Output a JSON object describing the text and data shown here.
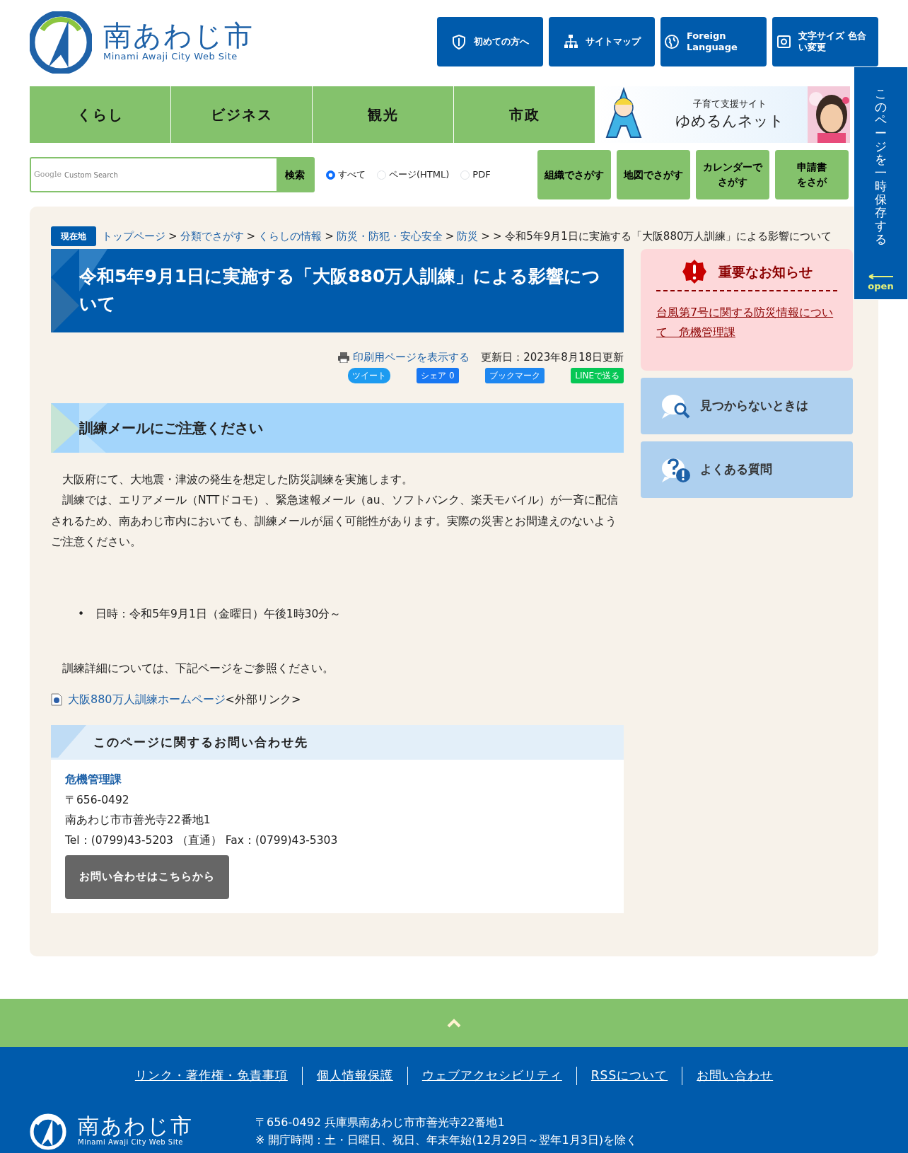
{
  "header": {
    "logo": {
      "name": "南あわじ市",
      "subtitle": "Minami Awaji City Web Site"
    },
    "buttons": [
      {
        "label": "初めての方へ"
      },
      {
        "label": "サイトマップ"
      },
      {
        "label": "Foreign Language"
      },
      {
        "label": "文字サイズ 色合い変更"
      }
    ]
  },
  "nav": {
    "items": [
      "くらし",
      "ビジネス",
      "観光",
      "市政"
    ],
    "banner": {
      "kicker": "子育て支援サイト",
      "title": "ゆめるんネット",
      "kind": "picture"
    }
  },
  "search": {
    "brand": "Google",
    "placeholder": "Custom Search",
    "button": "検索",
    "options": [
      {
        "label": "すべて",
        "selected": true
      },
      {
        "label": "ページ(HTML)",
        "selected": false
      },
      {
        "label": "PDF",
        "selected": false
      }
    ],
    "finders": [
      {
        "lines": [
          "組織でさがす"
        ]
      },
      {
        "lines": [
          "地図でさがす"
        ]
      },
      {
        "lines": [
          "カレンダーで",
          "さがす"
        ]
      },
      {
        "lines": [
          "申請書",
          "をさが"
        ]
      }
    ]
  },
  "side_tab": {
    "text": "このページを一時保存する",
    "action": "open"
  },
  "breadcrumb": {
    "label": "現在地",
    "parts": [
      {
        "kind": "link",
        "text": "トップページ"
      },
      {
        "kind": "sep",
        "text": ">"
      },
      {
        "kind": "link",
        "text": "分類でさがす"
      },
      {
        "kind": "sep",
        "text": ">"
      },
      {
        "kind": "link",
        "text": "くらしの情報"
      },
      {
        "kind": "sep",
        "text": ">"
      },
      {
        "kind": "link",
        "text": "防災・防犯・安心安全"
      },
      {
        "kind": "sep",
        "text": ">"
      },
      {
        "kind": "link",
        "text": "防災"
      },
      {
        "kind": "sep",
        "text": ">"
      },
      {
        "kind": "current",
        "text": "> 令和5年9月1日に実施する「大阪880万人訓練」による影響について"
      }
    ]
  },
  "article": {
    "title": "令和5年9月1日に実施する「大阪880万人訓練」による影響について",
    "print_link": "印刷用ページを表示する",
    "updated": "更新日：2023年8月18日更新",
    "share": [
      {
        "kind": "twitter",
        "label": "ツイート"
      },
      {
        "kind": "facebook",
        "label": "シェア 0"
      },
      {
        "kind": "hatena",
        "label": "ブックマーク"
      },
      {
        "kind": "line",
        "label": "LINEで送る"
      }
    ],
    "heading": "訓練メールにご注意ください",
    "paragraphs": [
      "　大阪府にて、大地震・津波の発生を想定した防災訓練を実施します。",
      "　訓練では、エリアメール（NTTドコモ）、緊急速報メール（au、ソフトバンク、楽天モバイル）が一斉に配信されるため、南あわじ市内においても、訓練メールが届く可能性があります。実際の災害とお間違えのないようご注意ください。"
    ],
    "bullets": [
      {
        "marker": "•",
        "text": "日時：令和5年9月1日（金曜日）午後1時30分～"
      }
    ],
    "detail": "　訓練詳細については、下記ページをご参照ください。",
    "external": {
      "link": "大阪880万人訓練ホームページ",
      "note": "<外部リンク>"
    }
  },
  "contact": {
    "heading": "このページに関するお問い合わせ先",
    "department": "危機管理課",
    "postal": "〒656-0492",
    "address": "南あわじ市市善光寺22番地1",
    "phone": "Tel：(0799)43-5203 （直通） Fax：(0799)43-5303",
    "button": "お問い合わせはこちらから"
  },
  "sidebar": {
    "notice": {
      "title": "重要なお知らせ",
      "links": [
        "台風第7号に関する防災情報について　危機管理課"
      ]
    },
    "panels": [
      {
        "label": "見つからないときは"
      },
      {
        "label": "よくある質問"
      }
    ]
  },
  "footer": {
    "links": [
      "リンク・著作権・免責事項",
      "個人情報保護",
      "ウェブアクセシビリティ",
      "RSSについて",
      "お問い合わせ"
    ],
    "logo": {
      "name": "南あわじ市",
      "subtitle": "Minami Awaji City Web Site"
    },
    "address": [
      "〒656-0492 兵庫県南あわじ市市善光寺22番地1",
      "※ 開庁時間：土・日曜日、祝日、年末年始(12月29日～翌年1月3日)を除く"
    ]
  }
}
